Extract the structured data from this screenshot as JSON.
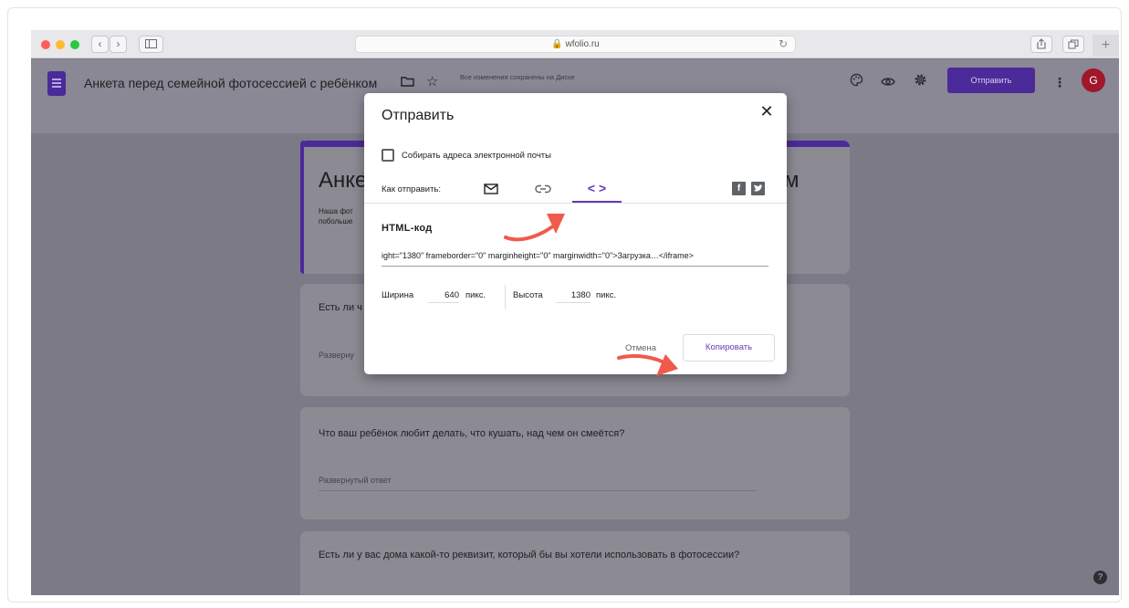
{
  "browser": {
    "url": "wfolio.ru",
    "back_icon": "chevron-left",
    "forward_icon": "chevron-right",
    "sidebar_icon": "sidebar",
    "reload_icon": "reload"
  },
  "header": {
    "title": "Анкета перед семейной фотосессией с ребёнком",
    "saved_status": "Все изменения сохранены на Диске",
    "send_button": "Отправить",
    "avatar_letter": "G",
    "icons": [
      "palette-icon",
      "eye-icon",
      "gear-icon",
      "more-vert-icon"
    ]
  },
  "form": {
    "title_partial": "Анке",
    "title_end": "м",
    "description_partial": "Наша фот\nпобольше",
    "cards": [
      {
        "question_partial": "Есть ли ч",
        "answer_partial": "Разверну"
      },
      {
        "question": "Что ваш ребёнок любит делать, что кушать, над чем он смеётся?",
        "answer": "Развернутый ответ"
      },
      {
        "question": "Есть ли у вас дома какой-то реквизит, который бы вы хотели использовать в фотосессии?"
      }
    ]
  },
  "dialog": {
    "title": "Отправить",
    "collect_emails_label": "Собирать адреса электронной почты",
    "collect_emails_checked": false,
    "send_via_label": "Как отправить:",
    "tabs": [
      {
        "icon": "email-icon",
        "active": false
      },
      {
        "icon": "link-icon",
        "active": false
      },
      {
        "icon": "embed-code-icon",
        "active": true
      }
    ],
    "social": [
      "facebook-icon",
      "twitter-icon"
    ],
    "html_label": "HTML-код",
    "html_code_visible": "ight=\"1380\" frameborder=\"0\" marginheight=\"0\" marginwidth=\"0\">Загрузка…</iframe>",
    "width_label": "Ширина",
    "width_value": "640",
    "height_label": "Высота",
    "height_value": "1380",
    "unit": "пикс.",
    "cancel_button": "Отмена",
    "copy_button": "Копировать"
  }
}
